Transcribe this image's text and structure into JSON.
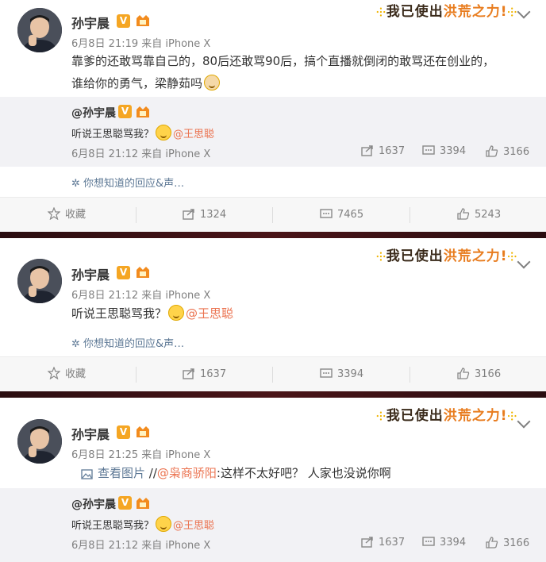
{
  "banner": {
    "part1": "我已使出",
    "part2": "洪荒之力",
    "mark": "!"
  },
  "posts": [
    {
      "author": "孙宇晨",
      "vbadge": "V",
      "meta": "6月8日 21:19 来自 iPhone X",
      "text_line1": "靠爹的还敢骂靠自己的，80后还敢骂90后，搞个直播就倒闭的敢骂还在创业的，",
      "text_line2": "谁给你的勇气，梁静茹吗",
      "quote": {
        "author": "@孙宇晨",
        "text": "听说王思聪骂我？",
        "mention": "@王思聪",
        "meta": "6月8日 21:12 来自 iPhone X",
        "reposts": "1637",
        "comments": "3394",
        "likes": "3166"
      },
      "hint": "你想知道的回应&声…",
      "actions": {
        "collect": "收藏",
        "reposts": "1324",
        "comments": "7465",
        "likes": "5243"
      }
    },
    {
      "author": "孙宇晨",
      "vbadge": "V",
      "meta": "6月8日 21:12 来自 iPhone X",
      "text": "听说王思聪骂我？",
      "mention": "@王思聪",
      "hint": "你想知道的回应&声…",
      "actions": {
        "collect": "收藏",
        "reposts": "1637",
        "comments": "3394",
        "likes": "3166"
      }
    },
    {
      "author": "孙宇晨",
      "vbadge": "V",
      "meta": "6月8日 21:25 来自 iPhone X",
      "view_image": "查看图片",
      "repost_prefix": " //",
      "repost_mention": "@枭商骄阳",
      "repost_text": ":这样不太好吧？  人家也没说你啊",
      "quote": {
        "author": "@孙宇晨",
        "text": "听说王思聪骂我？",
        "mention": "@王思聪",
        "meta": "6月8日 21:12 来自 iPhone X",
        "reposts": "1637",
        "comments": "3394",
        "likes": "3166"
      }
    }
  ]
}
